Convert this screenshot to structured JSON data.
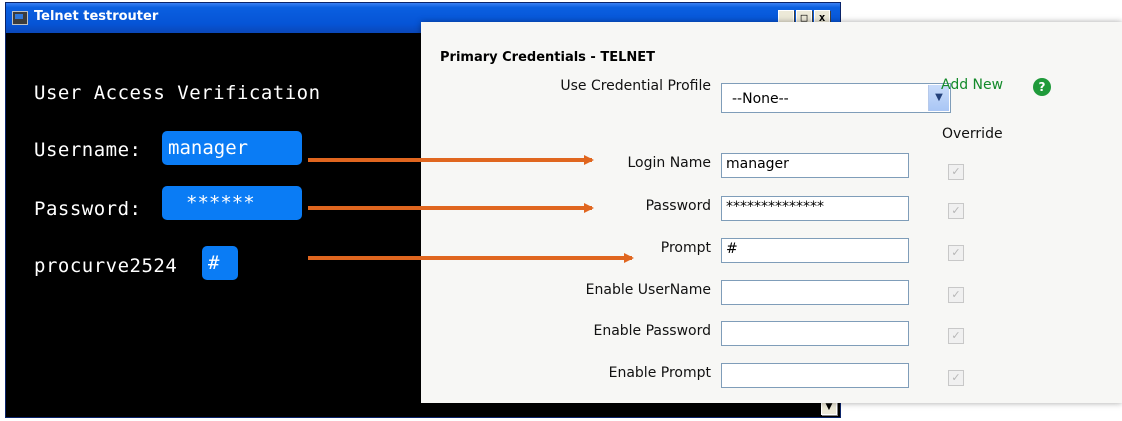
{
  "telnet_window": {
    "title": "Telnet testrouter",
    "controls": {
      "minimize": "_",
      "maximize": "□",
      "close": "x"
    },
    "console": {
      "banner": "User Access Verification",
      "username_label": "Username:",
      "username_value": "manager",
      "password_label": "Password:",
      "password_value": "******",
      "prompt_host": "procurve2524",
      "prompt_char": "#"
    },
    "scroll_down": "▼"
  },
  "credentials_panel": {
    "title": "Primary Credentials - TELNET",
    "credential_profile": {
      "label": "Use Credential Profile",
      "selected": "--None--"
    },
    "add_new": "Add New",
    "help_icon": "?",
    "override_header": "Override",
    "fields": [
      {
        "label": "Login Name",
        "value": "manager",
        "override_checked": true
      },
      {
        "label": "Password",
        "value": "**************",
        "override_checked": true
      },
      {
        "label": "Prompt",
        "value": "#",
        "override_checked": true
      },
      {
        "label": "Enable UserName",
        "value": "",
        "override_checked": true
      },
      {
        "label": "Enable Password",
        "value": "",
        "override_checked": true
      },
      {
        "label": "Enable Prompt",
        "value": "",
        "override_checked": true
      }
    ]
  },
  "colors": {
    "console_bg": "#000000",
    "highlight": "#0a7cf5",
    "arrow": "#e0661f",
    "add_new": "#138a2a",
    "titlebar": "#0654d6"
  }
}
